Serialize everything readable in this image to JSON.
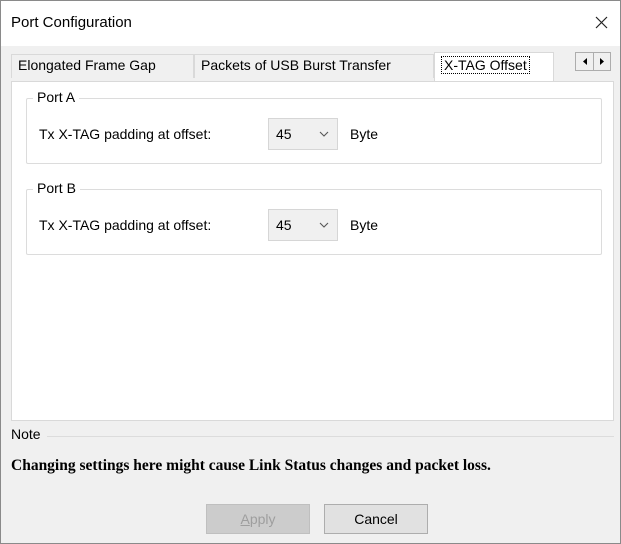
{
  "window": {
    "title": "Port Configuration"
  },
  "tabs": [
    {
      "label": "Elongated Frame Gap",
      "selected": false
    },
    {
      "label": "Packets of USB Burst Transfer",
      "selected": false
    },
    {
      "label": "X-TAG Offset",
      "selected": true
    }
  ],
  "tab_scroll": {
    "left_icon": "arrow-left-icon",
    "right_icon": "arrow-right-icon"
  },
  "ports": [
    {
      "group_label": "Port A",
      "field_label": "Tx X-TAG padding at offset:",
      "value": "45",
      "unit": "Byte"
    },
    {
      "group_label": "Port B",
      "field_label": "Tx X-TAG padding at offset:",
      "value": "45",
      "unit": "Byte"
    }
  ],
  "note": {
    "label": "Note",
    "text": "Changing settings here might cause Link Status changes and packet loss."
  },
  "buttons": {
    "apply_first": "A",
    "apply_rest": "pply",
    "cancel": "Cancel"
  },
  "colors": {
    "window_bg": "#f0f0f0",
    "panel_bg": "#ffffff",
    "disabled_text": "#9e9e9e"
  }
}
